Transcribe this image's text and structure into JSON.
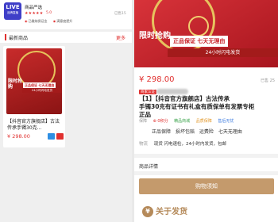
{
  "store": {
    "logo_text": "LIVE",
    "logo_sub": "品牌直播",
    "name": "商品严选",
    "stars": "★★★★★",
    "rating": "5.0",
    "followers": "已售15",
    "tags": [
      "已缴纳保证金",
      "满意度提升"
    ]
  },
  "section": {
    "title": "最新商品",
    "more": "更多"
  },
  "product_card": {
    "promo_a": "限时抢购",
    "promo_b": "正品保证 七天无理由",
    "band": "24小时闪电发货",
    "title": "【抖音官方旗舰店】古法传承手镯30克...",
    "price": "¥ 298.00"
  },
  "detail": {
    "hero": {
      "promo_a": "限时抢购",
      "promo_b": "正品保证 七天无理由",
      "band": "24小时闪电发货"
    },
    "price": "¥ 298.00",
    "sold": "已售 25",
    "pill": "商家认证",
    "title_lines": [
      "【1】【抖音官方旗舰店】古法传承",
      "手镯30克有证书有礼盒有质保单有发票专柜",
      "正品"
    ],
    "row1": {
      "label": "保障",
      "points": "⊕ 0积分",
      "g": "精品商城",
      "o": "品质保障",
      "b": "售后无忧"
    },
    "row2": [
      "正品保障",
      "损坏包赔",
      "运费险",
      "七天无理由"
    ],
    "row3": {
      "label": "物流",
      "text": "现货 闪电速检，24小时内发货，包邮"
    },
    "details_label": "商品详情",
    "notice_button": "购物须知",
    "about": "关于发货"
  }
}
